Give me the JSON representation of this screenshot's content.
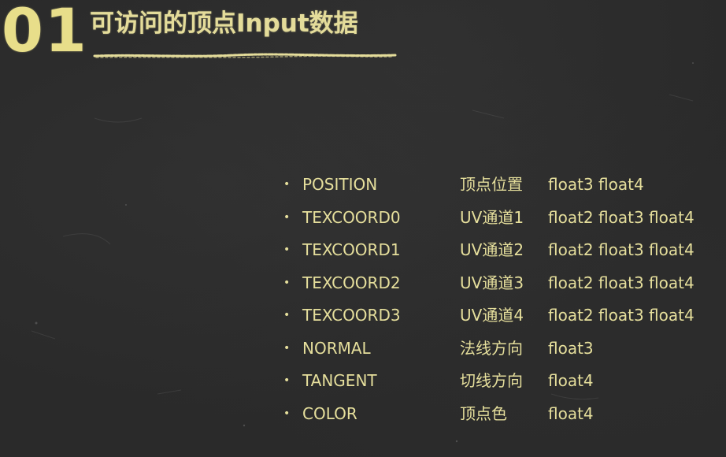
{
  "header": {
    "number": "01",
    "title": "可访问的顶点Input数据"
  },
  "attributes": [
    {
      "semantic": "POSITION",
      "meaning": "顶点位置",
      "types": "float3 float4"
    },
    {
      "semantic": "TEXCOORD0",
      "meaning": "UV通道1",
      "types": "float2 float3 float4"
    },
    {
      "semantic": "TEXCOORD1",
      "meaning": "UV通道2",
      "types": "float2 float3 float4"
    },
    {
      "semantic": "TEXCOORD2",
      "meaning": "UV通道3",
      "types": "float2 float3 float4"
    },
    {
      "semantic": "TEXCOORD3",
      "meaning": "UV通道4",
      "types": "float2 float3 float4"
    },
    {
      "semantic": "NORMAL",
      "meaning": "法线方向",
      "types": "float3"
    },
    {
      "semantic": "TANGENT",
      "meaning": "切线方向",
      "types": "float4"
    },
    {
      "semantic": "COLOR",
      "meaning": "顶点色",
      "types": "float4"
    }
  ],
  "colors": {
    "chalk": "#e6df9c",
    "board": "#2a2a2a"
  }
}
